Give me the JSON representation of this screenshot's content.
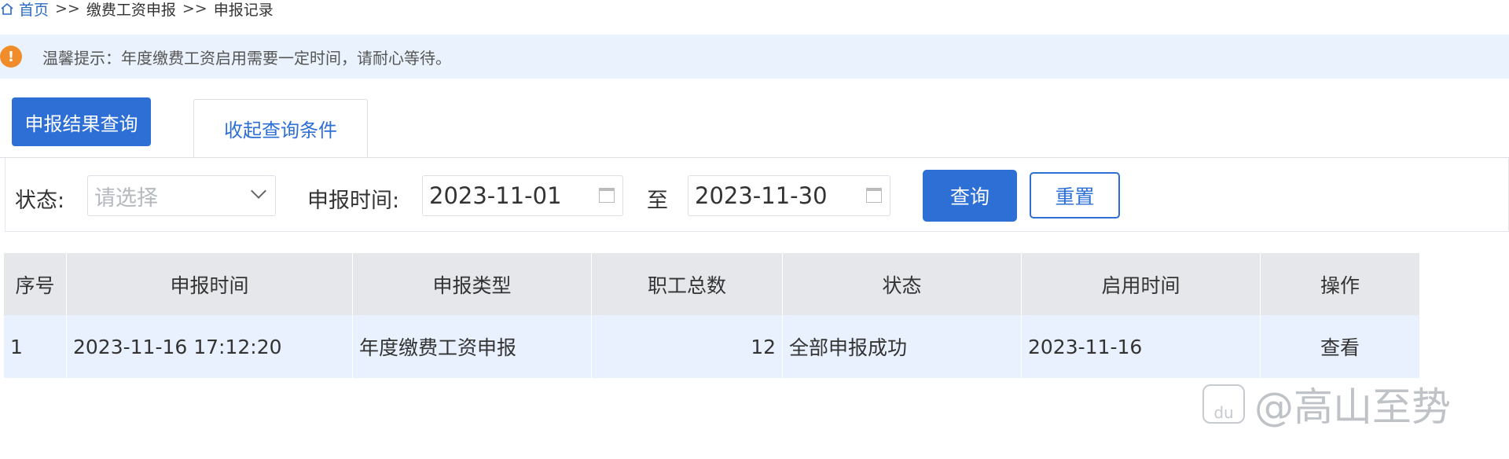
{
  "breadcrumb": {
    "home": "首页",
    "separator": ">>",
    "items": [
      "缴费工资申报",
      "申报记录"
    ]
  },
  "notice": {
    "icon": "info-icon",
    "text": "温馨提示：年度缴费工资启用需要一定时间，请耐心等待。"
  },
  "tabs": {
    "active_label": "申报结果查询",
    "toggle_label": "收起查询条件"
  },
  "filter": {
    "status_label": "状态:",
    "status_placeholder": "请选择",
    "date_label": "申报时间:",
    "date_from": "2023-11-01",
    "to_label": "至",
    "date_to": "2023-11-30",
    "query_label": "查询",
    "reset_label": "重置"
  },
  "table": {
    "headers": [
      "序号",
      "申报时间",
      "申报类型",
      "职工总数",
      "状态",
      "启用时间",
      "操作"
    ],
    "rows": [
      {
        "index": "1",
        "time": "2023-11-16 17:12:20",
        "type": "年度缴费工资申报",
        "count": "12",
        "status": "全部申报成功",
        "enable_time": "2023-11-16",
        "action": "查看"
      }
    ]
  },
  "watermark": {
    "text": "@高山至势",
    "logo": "du"
  },
  "colors": {
    "primary": "#2e6fd6",
    "notice_bg": "#eaf3fd",
    "info_orange": "#f08c2a",
    "row_bg": "#e8f1fd",
    "header_bg": "#e5e7ea"
  }
}
